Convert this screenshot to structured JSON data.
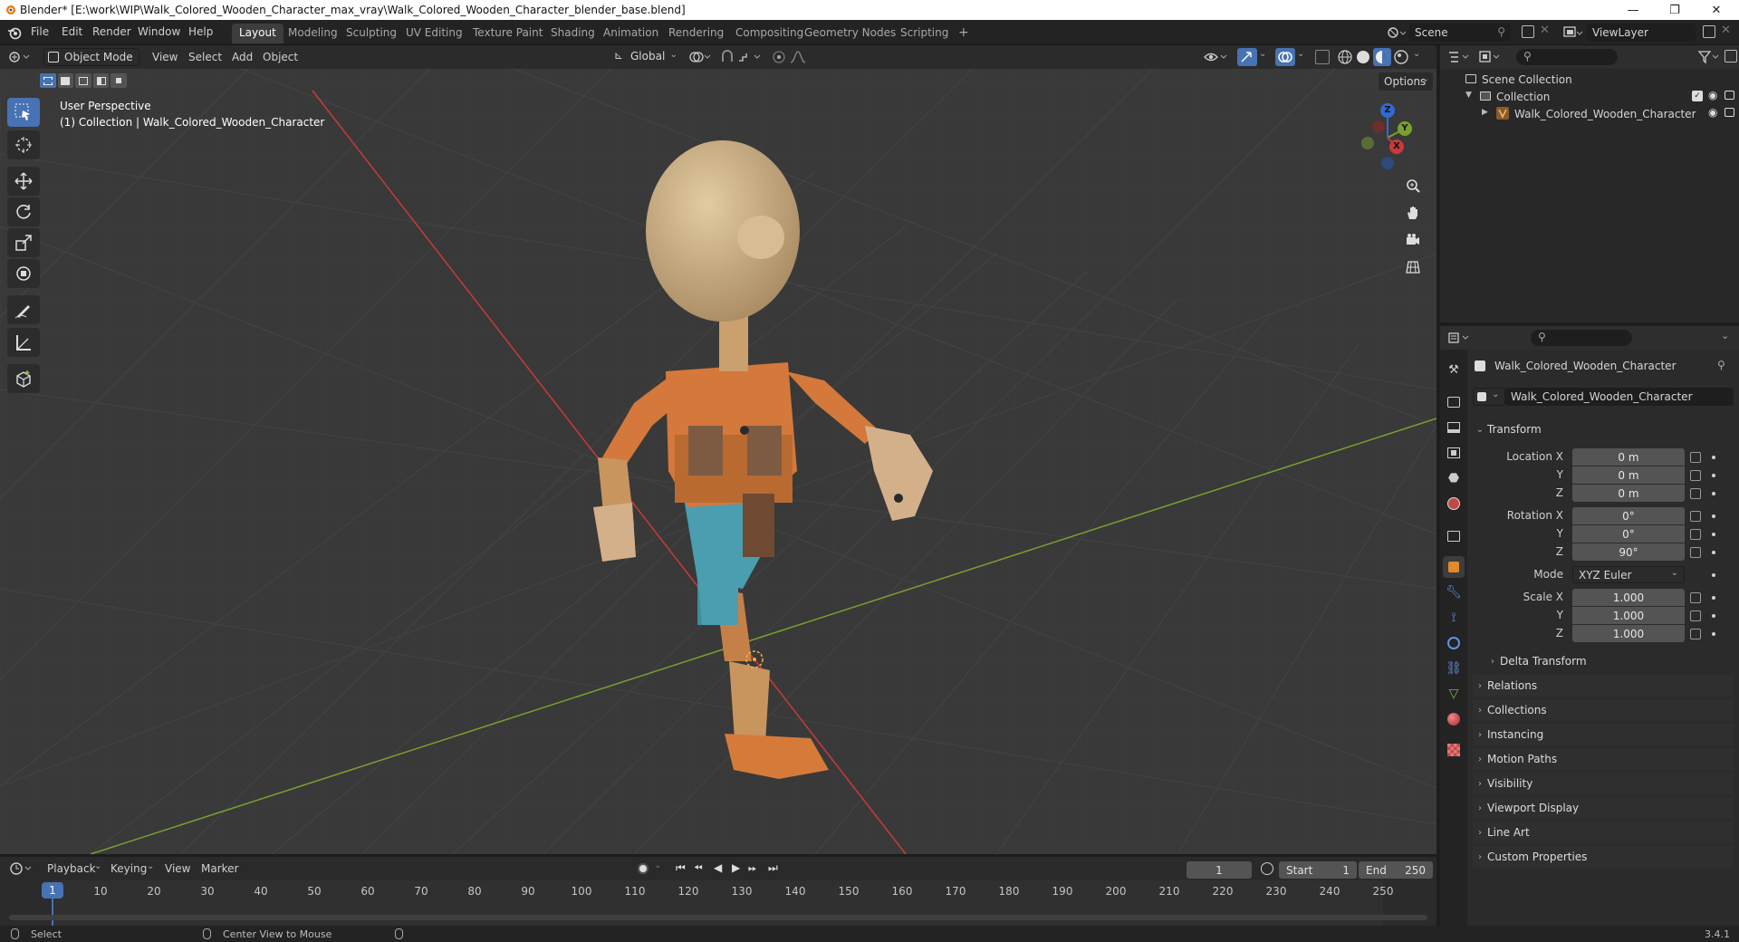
{
  "window": {
    "title": "Blender* [E:\\work\\WIP\\Walk_Colored_Wooden_Character_max_vray\\Walk_Colored_Wooden_Character_blender_base.blend]",
    "minimize": "—",
    "maximize": "❐",
    "close": "✕"
  },
  "menubar": {
    "items": [
      "File",
      "Edit",
      "Render",
      "Window",
      "Help"
    ],
    "workspaces": [
      "Layout",
      "Modeling",
      "Sculpting",
      "UV Editing",
      "Texture Paint",
      "Shading",
      "Animation",
      "Rendering",
      "Compositing",
      "Geometry Nodes",
      "Scripting"
    ],
    "active_workspace": "Layout",
    "add_tab": "+",
    "scene": "Scene",
    "view_layer": "ViewLayer"
  },
  "viewport": {
    "mode": "Object Mode",
    "menus": [
      "View",
      "Select",
      "Add",
      "Object"
    ],
    "orientation": "Global",
    "options": "Options",
    "perspective": "User Perspective",
    "collection_info": "(1) Collection | Walk_Colored_Wooden_Character",
    "axis_x": "X",
    "axis_y": "Y",
    "axis_z": "Z"
  },
  "outliner": {
    "scene_collection": "Scene Collection",
    "collection": "Collection",
    "object": "Walk_Colored_Wooden_Character"
  },
  "properties": {
    "object_name": "Walk_Colored_Wooden_Character",
    "datablock": "Walk_Colored_Wooden_Character",
    "transform_label": "Transform",
    "location_label": "Location X",
    "location": [
      "0 m",
      "0 m",
      "0 m"
    ],
    "rotation_label": "Rotation X",
    "rotation": [
      "0°",
      "0°",
      "90°"
    ],
    "axis_y": "Y",
    "axis_z": "Z",
    "mode_label": "Mode",
    "mode_value": "XYZ Euler",
    "scale_label": "Scale X",
    "scale": [
      "1.000",
      "1.000",
      "1.000"
    ],
    "delta_transform": "Delta Transform",
    "panels": [
      "Relations",
      "Collections",
      "Instancing",
      "Motion Paths",
      "Visibility",
      "Viewport Display",
      "Line Art",
      "Custom Properties"
    ]
  },
  "timeline": {
    "menus": [
      "Playback",
      "Keying",
      "View",
      "Marker"
    ],
    "current_frame": "1",
    "start_label": "Start",
    "start": "1",
    "end_label": "End",
    "end": "250",
    "ticks": [
      "1",
      "10",
      "20",
      "30",
      "40",
      "50",
      "60",
      "70",
      "80",
      "90",
      "100",
      "110",
      "120",
      "130",
      "140",
      "150",
      "160",
      "170",
      "180",
      "190",
      "200",
      "210",
      "220",
      "230",
      "240",
      "250"
    ]
  },
  "statusbar": {
    "select": "Select",
    "center_view": "Center View to Mouse",
    "version": "3.4.1"
  },
  "colors": {
    "accent": "#4772b3",
    "x_axis": "#c93a3a",
    "y_axis": "#7aa02e",
    "z_axis": "#2f6bd1"
  }
}
